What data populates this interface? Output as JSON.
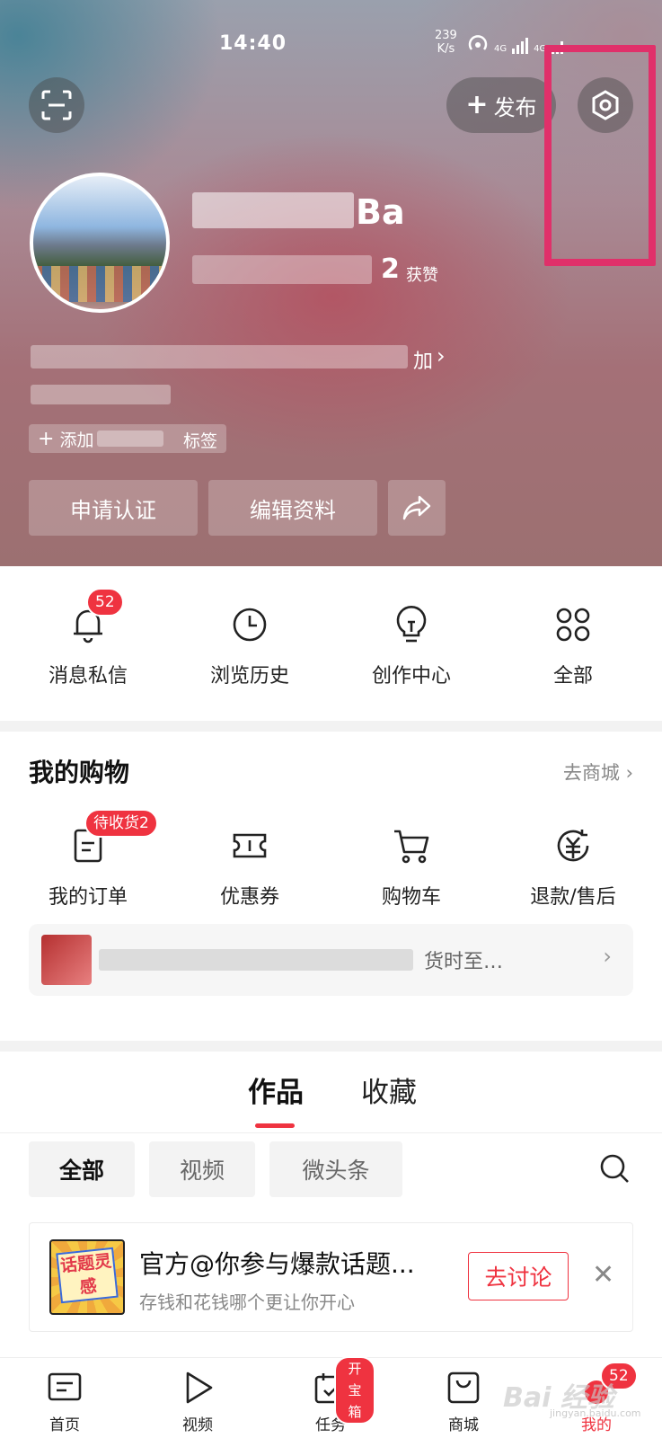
{
  "status_bar": {
    "time": "14:40",
    "net_speed_value": "239",
    "net_speed_unit": "K/s",
    "signal_label_1": "4G",
    "signal_label_2": "4G"
  },
  "header": {
    "publish_label": "发布",
    "name_suffix": "Ba",
    "fans_suffix": "2",
    "fans_label": "获赞",
    "bio_end": "加",
    "tag_prefix": "添加",
    "tag_suffix": "标签",
    "verify_label": "申请认证",
    "edit_label": "编辑资料"
  },
  "quick_actions": [
    {
      "label": "消息私信",
      "icon": "bell-icon",
      "badge": "52"
    },
    {
      "label": "浏览历史",
      "icon": "clock-icon"
    },
    {
      "label": "创作中心",
      "icon": "bulb-icon"
    },
    {
      "label": "全部",
      "icon": "grid-icon"
    }
  ],
  "shopping": {
    "title": "我的购物",
    "link_label": "去商城",
    "items": [
      {
        "label": "我的订单",
        "icon": "order-icon",
        "badge": "待收货2"
      },
      {
        "label": "优惠券",
        "icon": "coupon-icon"
      },
      {
        "label": "购物车",
        "icon": "cart-icon"
      },
      {
        "label": "退款/售后",
        "icon": "refund-icon"
      }
    ],
    "order_preview_tail": "货时至…"
  },
  "works": {
    "tabs": [
      "作品",
      "收藏"
    ],
    "filters": [
      "全部",
      "视频",
      "微头条"
    ],
    "promo": {
      "image_text": "话题灵感",
      "title": "官方@你参与爆款话题...",
      "subtitle": "存钱和花钱哪个更让你开心",
      "button": "去讨论"
    }
  },
  "bottom_nav": [
    {
      "label": "首页",
      "icon": "home-doc-icon"
    },
    {
      "label": "视频",
      "icon": "play-icon"
    },
    {
      "label": "任务",
      "icon": "task-calendar-icon",
      "badge": "开宝箱"
    },
    {
      "label": "商城",
      "icon": "bag-icon"
    },
    {
      "label": "我的",
      "icon": "mine-icon",
      "badge": "52"
    }
  ],
  "watermark": {
    "text": "Bai 经验",
    "sub": "jingyan.baidu.com"
  },
  "colors": {
    "accent": "#ef3340",
    "highlight": "#e0306a"
  }
}
